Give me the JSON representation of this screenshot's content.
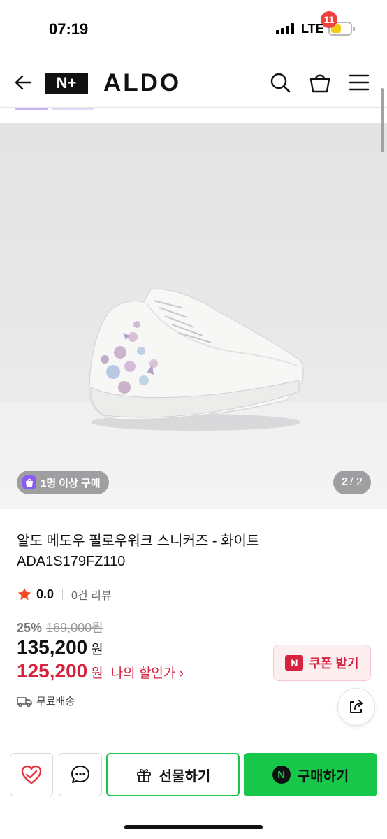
{
  "status_bar": {
    "time": "07:19",
    "network": "LTE",
    "battery_color": "#f4cc17"
  },
  "header": {
    "logo_left": "N+",
    "logo_brand": "ALDO",
    "cart_count": "11",
    "icons": [
      "back-arrow-icon",
      "search-icon",
      "cart-icon",
      "hamburger-menu-icon"
    ]
  },
  "gallery": {
    "buyers_badge": "1명 이상 구매",
    "page_current": "2",
    "page_total": "/ 2"
  },
  "product": {
    "title": "알도 메도우 필로우워크 스니커즈 - 화이트",
    "sku": "ADA1S179FZ110",
    "rating": "0.0",
    "reviews": "0건 리뷰",
    "discount_rate": "25%",
    "original_price": "169,000원",
    "price": "135,200",
    "price_unit": "원",
    "my_price": "125,200",
    "my_price_unit": "원",
    "my_price_label": "나의 할인가 ›",
    "shipping": "무료배송",
    "coupon_mark": "N",
    "coupon_label": "쿠폰 받기"
  },
  "bottom_bar": {
    "gift_label": "선물하기",
    "buy_mark": "N",
    "buy_label": "구매하기"
  },
  "colors": {
    "naver_green": "#17c74a",
    "discount_red": "#d6223e",
    "star": "#f04a23",
    "badge_red": "#f0413c"
  }
}
